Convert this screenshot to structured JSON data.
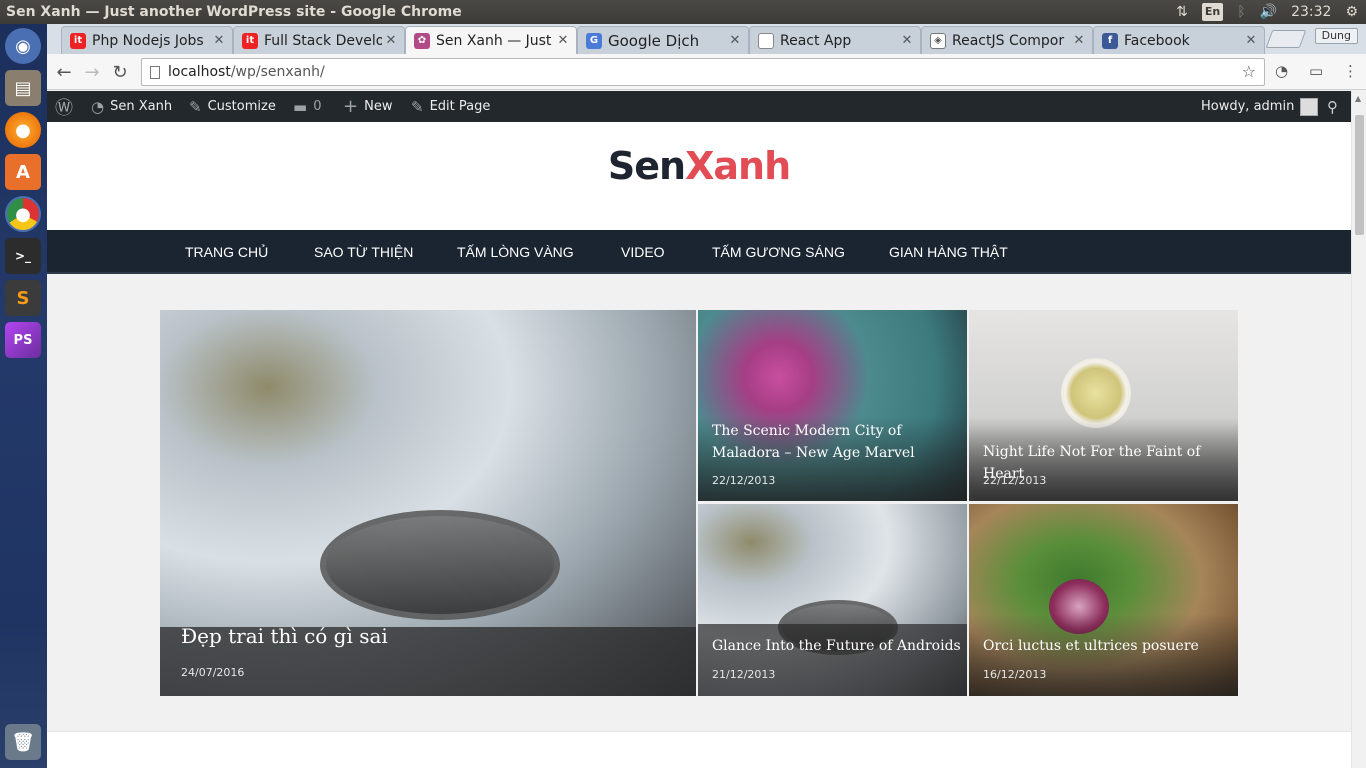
{
  "os": {
    "window_title": "Sen Xanh — Just another WordPress site - Google Chrome",
    "lang": "En",
    "clock": "23:32",
    "launcher": [
      {
        "name": "ubuntu-dash-icon",
        "glyph": "◉",
        "color": "#4a6fb3"
      },
      {
        "name": "files-icon",
        "glyph": "▤",
        "color": "#8a7f6f"
      },
      {
        "name": "firefox-icon",
        "glyph": "●",
        "color": "#e66000"
      },
      {
        "name": "software-center-icon",
        "glyph": "A",
        "color": "#e8702a"
      },
      {
        "name": "chrome-icon",
        "glyph": "◎",
        "color": "#2f8f46"
      },
      {
        "name": "terminal-icon",
        "glyph": ">_",
        "color": "#2c2c2c"
      },
      {
        "name": "sublime-icon",
        "glyph": "S",
        "color": "#3b3b3b"
      },
      {
        "name": "phpstorm-icon",
        "glyph": "PS",
        "color": "#8a2ea8"
      },
      {
        "name": "trash-icon",
        "glyph": "🗑",
        "color": "#6a7a8a"
      }
    ]
  },
  "browser": {
    "tabs": [
      {
        "label": "Php Nodejs Jobs",
        "fav": "it",
        "fav_color": "#e22",
        "active": false
      },
      {
        "label": "Full Stack Develo",
        "fav": "it",
        "fav_color": "#e22",
        "active": false
      },
      {
        "label": "Sen Xanh — Just",
        "fav": "✿",
        "fav_color": "#b14a86",
        "active": true
      },
      {
        "label": "Google Dịch",
        "fav": "G",
        "fav_color": "#4a7bd8",
        "active": false
      },
      {
        "label": "React App",
        "fav": "▯",
        "fav_color": "#888",
        "active": false
      },
      {
        "label": "ReactJS Compor",
        "fav": "◈",
        "fav_color": "#555",
        "active": false
      },
      {
        "label": "Facebook",
        "fav": "f",
        "fav_color": "#3b5998",
        "active": false
      }
    ],
    "profile": "Dung",
    "url_host": "localhost",
    "url_path": "/wp/senxanh/"
  },
  "adminbar": {
    "site": "Sen Xanh",
    "customize": "Customize",
    "comments": "0",
    "new": "New",
    "edit": "Edit Page",
    "howdy": "Howdy, admin"
  },
  "site": {
    "logo_a": "Sen",
    "logo_b": "Xanh",
    "nav": [
      "TRANG CHỦ",
      "SAO TỪ THIỆN",
      "TẤM LÒNG VÀNG",
      "VIDEO",
      "TẤM GƯƠNG SÁNG",
      "GIAN HÀNG THẬT"
    ]
  },
  "posts": [
    {
      "title": "Đẹp trai thì có gì sai",
      "date": "24/07/2016"
    },
    {
      "title": "The Scenic Modern City of Maladora – New Age Marvel",
      "date": "22/12/2013"
    },
    {
      "title": "Night Life Not For the Faint of Heart",
      "date": "22/12/2013"
    },
    {
      "title": "Glance Into the Future of Androids",
      "date": "21/12/2013"
    },
    {
      "title": "Orci luctus et ultrices posuere",
      "date": "16/12/2013"
    }
  ]
}
